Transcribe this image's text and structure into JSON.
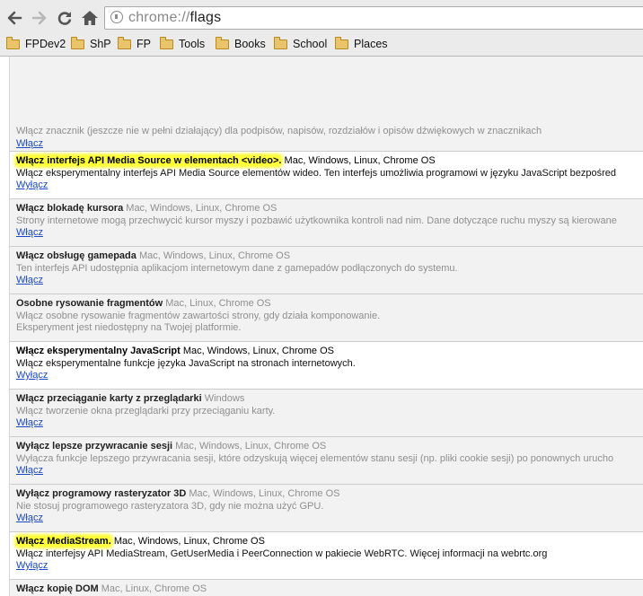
{
  "browser": {
    "url_scheme": "chrome://",
    "url_host": "flags",
    "icons": {
      "back": "back-arrow-icon",
      "forward": "forward-arrow-icon",
      "reload": "reload-icon",
      "home": "home-icon",
      "page": "page-info-icon",
      "folder": "folder-icon"
    }
  },
  "bookmarks": [
    "FPDev2",
    "ShP",
    "FP",
    "Tools",
    "Books",
    "School",
    "Places"
  ],
  "colors": {
    "highlight": "#ffff3a",
    "link": "#1b48c4",
    "disabled_text": "#8f8f8f"
  },
  "experiments": [
    {
      "state": "disabled",
      "title": "",
      "platforms": "",
      "description": "Włącz znacznik (jeszcze nie w pełni działający) dla podpisów, napisów, rozdziałów i opisów dźwiękowych w znacznikach",
      "note": "",
      "link": "Włącz"
    },
    {
      "state": "enabled",
      "title": "Włącz interfejs API Media Source w elementach <video>.",
      "platforms": "Mac, Windows, Linux, Chrome OS",
      "description": "Włącz eksperymentalny interfejs API Media Source elementów wideo. Ten interfejs umożliwia programowi w języku JavaScript bezpośred",
      "note": "",
      "link": "Wyłącz",
      "highlight": true
    },
    {
      "state": "disabled",
      "title": "Włącz blokadę kursora",
      "platforms": "Mac, Windows, Linux, Chrome OS",
      "description": "Strony internetowe mogą przechwycić kursor myszy i pozbawić użytkownika kontroli nad nim. Dane dotyczące ruchu myszy są kierowane",
      "note": "",
      "link": "Włącz"
    },
    {
      "state": "disabled",
      "title": "Włącz obsługę gamepada",
      "platforms": "Mac, Windows, Linux, Chrome OS",
      "description": "Ten interfejs API udostępnia aplikacjom internetowym dane z gamepadów podłączonych do systemu.",
      "note": "",
      "link": "Włącz"
    },
    {
      "state": "disabled",
      "title": "Osobne rysowanie fragmentów",
      "platforms": "Mac, Linux, Chrome OS",
      "description": "Włącz osobne rysowanie fragmentów zawartości strony, gdy działa komponowanie.",
      "note": "Eksperyment jest niedostępny na Twojej platformie.",
      "link": ""
    },
    {
      "state": "enabled",
      "title": "Włącz eksperymentalny JavaScript",
      "platforms": "Mac, Windows, Linux, Chrome OS",
      "description": "Włącz eksperymentalne funkcje języka JavaScript na stronach internetowych.",
      "note": "",
      "link": "Wyłącz"
    },
    {
      "state": "disabled",
      "title": "Włącz przeciąganie karty z przeglądarki",
      "platforms": "Windows",
      "description": "Włącz tworzenie okna przeglądarki przy przeciąganiu karty.",
      "note": "",
      "link": "Włącz"
    },
    {
      "state": "disabled",
      "title": "Wyłącz lepsze przywracanie sesji",
      "platforms": "Mac, Windows, Linux, Chrome OS",
      "description": "Wyłącza funkcje lepszego przywracania sesji, które odzyskują więcej elementów stanu sesji (np. pliki cookie sesji) po ponownych urucho",
      "note": "",
      "link": "Włącz"
    },
    {
      "state": "disabled",
      "title": "Wyłącz programowy rasteryzator 3D",
      "platforms": "Mac, Windows, Linux, Chrome OS",
      "description": "Nie stosuj programowego rasteryzatora 3D, gdy nie można użyć GPU.",
      "note": "",
      "link": "Włącz"
    },
    {
      "state": "enabled",
      "title": "Włącz MediaStream.",
      "platforms": "Mac, Windows, Linux, Chrome OS",
      "description": "Włącz interfejsy API MediaStream, GetUserMedia i PeerConnection w pakiecie WebRTC. Więcej informacji na webrtc.org",
      "note": "",
      "link": "Wyłącz",
      "highlight": true
    },
    {
      "state": "disabled",
      "title": "Włącz kopię DOM",
      "platforms": "Mac, Linux, Chrome OS",
      "description": "",
      "note": "",
      "link": ""
    }
  ]
}
